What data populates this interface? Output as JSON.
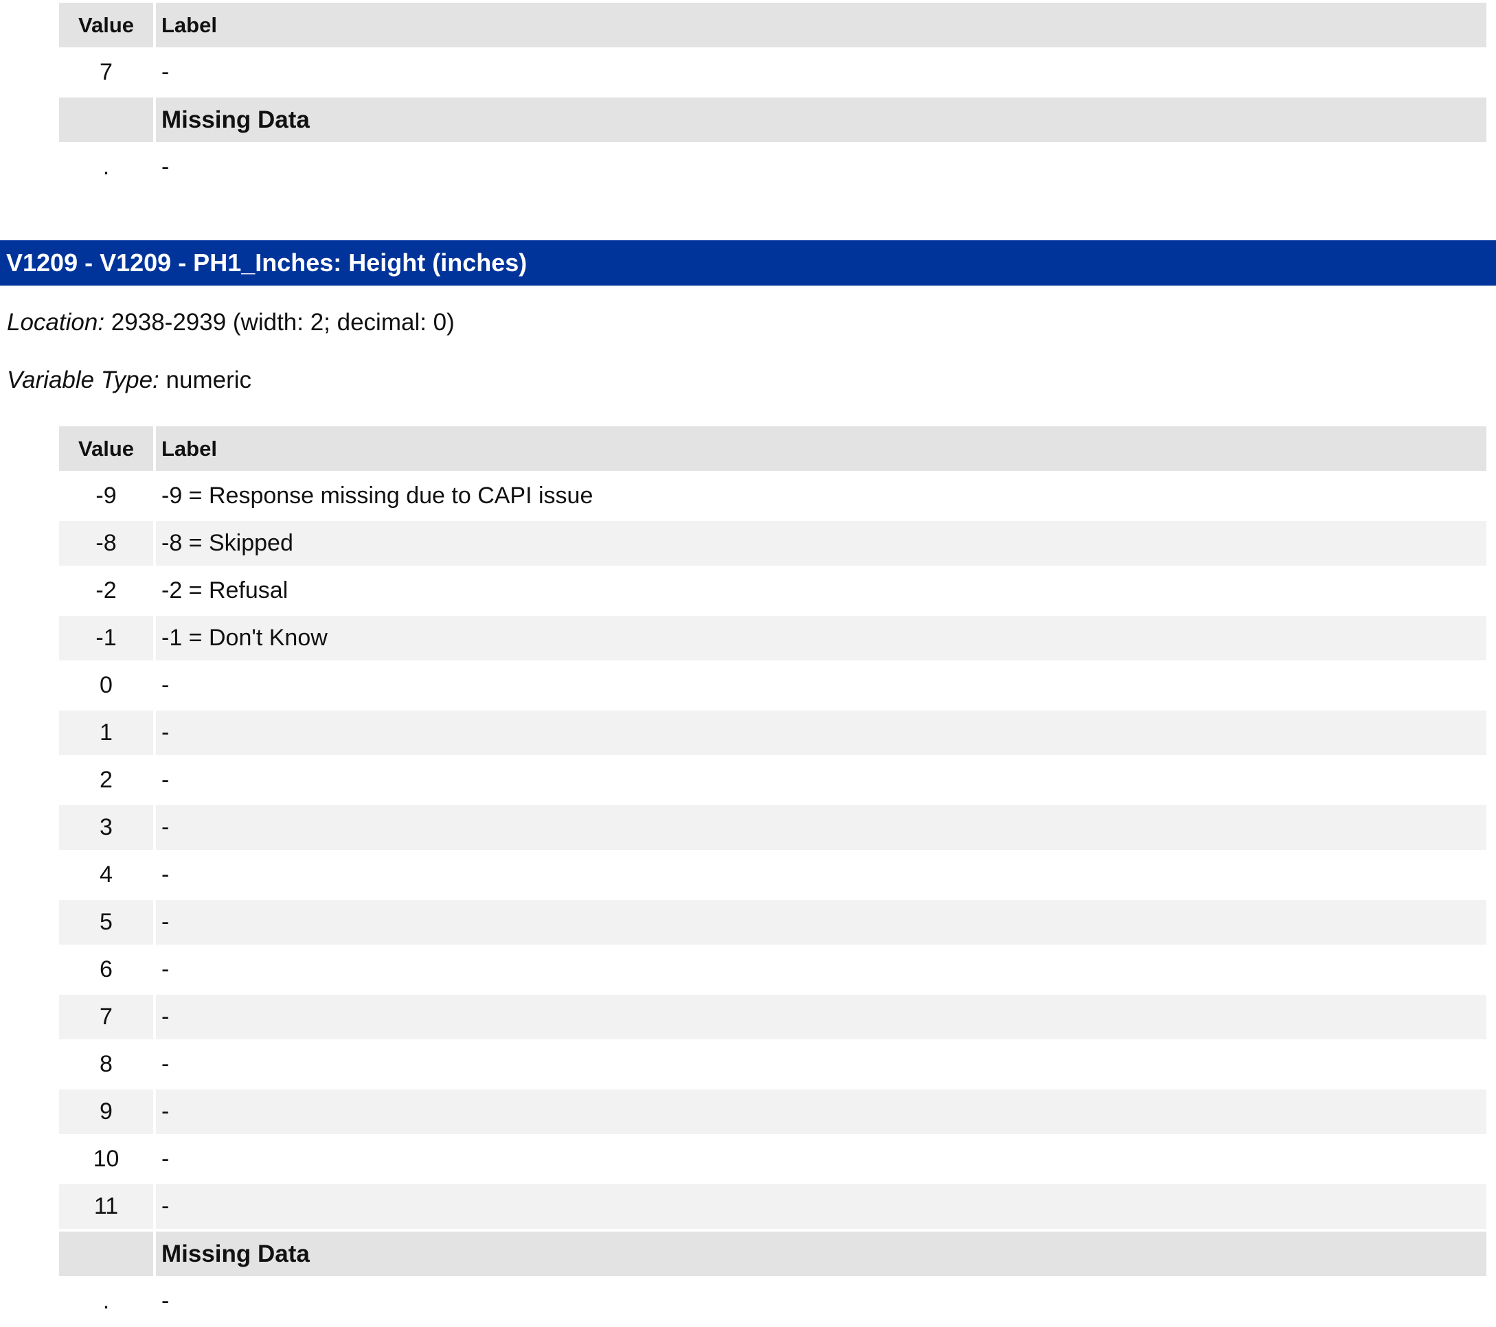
{
  "top_table": {
    "headers": {
      "value": "Value",
      "label": "Label"
    },
    "rows": [
      {
        "value": "7",
        "label": "-"
      }
    ],
    "missing_heading": "Missing Data",
    "missing_rows": [
      {
        "value": ".",
        "label": "-"
      }
    ]
  },
  "variable": {
    "title": "V1209 - V1209 - PH1_Inches: Height (inches)",
    "location_key": "Location:",
    "location_value": "2938-2939 (width: 2; decimal: 0)",
    "type_key": "Variable Type:",
    "type_value": "numeric"
  },
  "main_table": {
    "headers": {
      "value": "Value",
      "label": "Label"
    },
    "rows": [
      {
        "value": "-9",
        "label": "-9 = Response missing due to CAPI issue"
      },
      {
        "value": "-8",
        "label": "-8 = Skipped"
      },
      {
        "value": "-2",
        "label": "-2 = Refusal"
      },
      {
        "value": "-1",
        "label": "-1 = Don't Know"
      },
      {
        "value": "0",
        "label": "-"
      },
      {
        "value": "1",
        "label": "-"
      },
      {
        "value": "2",
        "label": "-"
      },
      {
        "value": "3",
        "label": "-"
      },
      {
        "value": "4",
        "label": "-"
      },
      {
        "value": "5",
        "label": "-"
      },
      {
        "value": "6",
        "label": "-"
      },
      {
        "value": "7",
        "label": "-"
      },
      {
        "value": "8",
        "label": "-"
      },
      {
        "value": "9",
        "label": "-"
      },
      {
        "value": "10",
        "label": "-"
      },
      {
        "value": "11",
        "label": "-"
      }
    ],
    "missing_heading": "Missing Data",
    "missing_rows": [
      {
        "value": ".",
        "label": "-"
      }
    ]
  },
  "colors": {
    "header_bar": "#00349b",
    "table_header": "#e3e3e3",
    "row_stripe": "#f2f2f2"
  }
}
